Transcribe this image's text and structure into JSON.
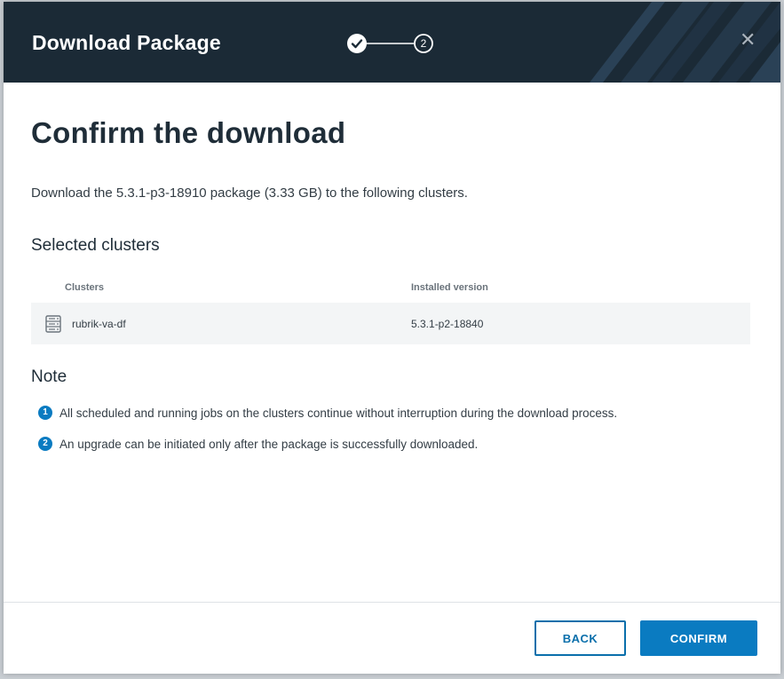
{
  "header": {
    "title": "Download Package",
    "stepper": {
      "steps": [
        {
          "state": "completed"
        },
        {
          "state": "current",
          "label": "2"
        }
      ]
    }
  },
  "main": {
    "title": "Confirm the download",
    "description": "Download the 5.3.1-p3-18910 package (3.33 GB) to the following clusters.",
    "selected_clusters": {
      "title": "Selected clusters",
      "columns": [
        "Clusters",
        "Installed version"
      ],
      "rows": [
        {
          "icon": "server-icon",
          "name": "rubrik-va-df",
          "version": "5.3.1-p2-18840"
        }
      ]
    },
    "note": {
      "title": "Note",
      "items": [
        {
          "num": "1",
          "text": "All scheduled and running jobs on the clusters continue without interruption during the download process."
        },
        {
          "num": "2",
          "text": "An upgrade can be initiated only after the package is successfully downloaded."
        }
      ]
    }
  },
  "footer": {
    "back_label": "BACK",
    "confirm_label": "CONFIRM"
  },
  "colors": {
    "header_bg": "#1b2a36",
    "accent": "#0a7bc1",
    "text_dark": "#1f2d38",
    "row_bg": "#f3f5f6"
  },
  "icons": {
    "close": "close-icon",
    "step_done": "checkmark-icon",
    "cluster": "server-icon"
  }
}
